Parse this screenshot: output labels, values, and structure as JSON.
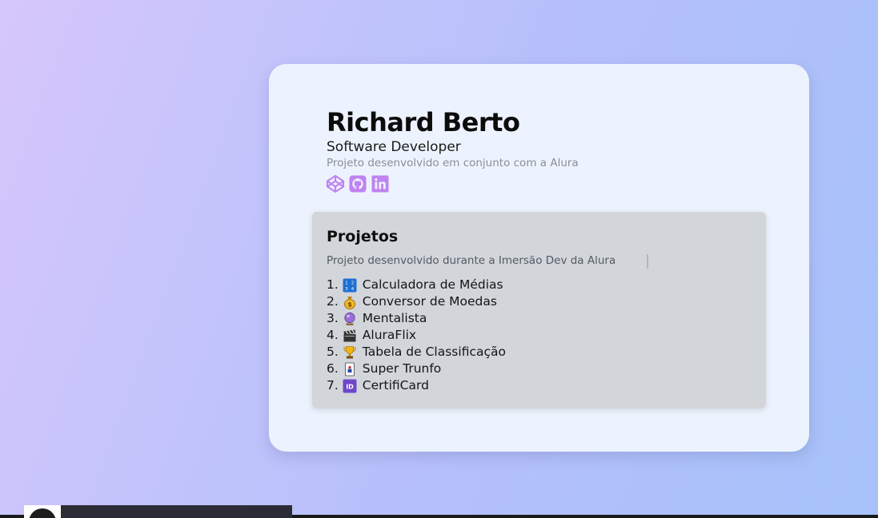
{
  "profile": {
    "name": "Richard Berto",
    "role": "Software Developer",
    "subtitle": "Projeto desenvolvido em conjunto com a Alura",
    "socials": [
      {
        "icon": "codepen-icon"
      },
      {
        "icon": "github-icon"
      },
      {
        "icon": "linkedin-icon"
      }
    ]
  },
  "projects_section": {
    "title": "Projetos",
    "description": "Projeto desenvolvido durante a Imersão Dev da Alura",
    "items": [
      {
        "number": "1.",
        "emoji": "numbers-icon",
        "label": "Calculadora de Médias"
      },
      {
        "number": "2.",
        "emoji": "money-bag-icon",
        "label": "Conversor de Moedas"
      },
      {
        "number": "3.",
        "emoji": "crystal-ball-icon",
        "label": "Mentalista"
      },
      {
        "number": "4.",
        "emoji": "clapper-board-icon",
        "label": "AluraFlix"
      },
      {
        "number": "5.",
        "emoji": "trophy-icon",
        "label": "Tabela de Classificação"
      },
      {
        "number": "6.",
        "emoji": "playing-card-icon",
        "label": "Super Trunfo"
      },
      {
        "number": "7.",
        "emoji": "id-icon",
        "label": "CertifiCard"
      }
    ]
  },
  "colors": {
    "accent": "#c083f0",
    "card_background": "#edf3fe",
    "panel_background": "#d2d5da"
  }
}
